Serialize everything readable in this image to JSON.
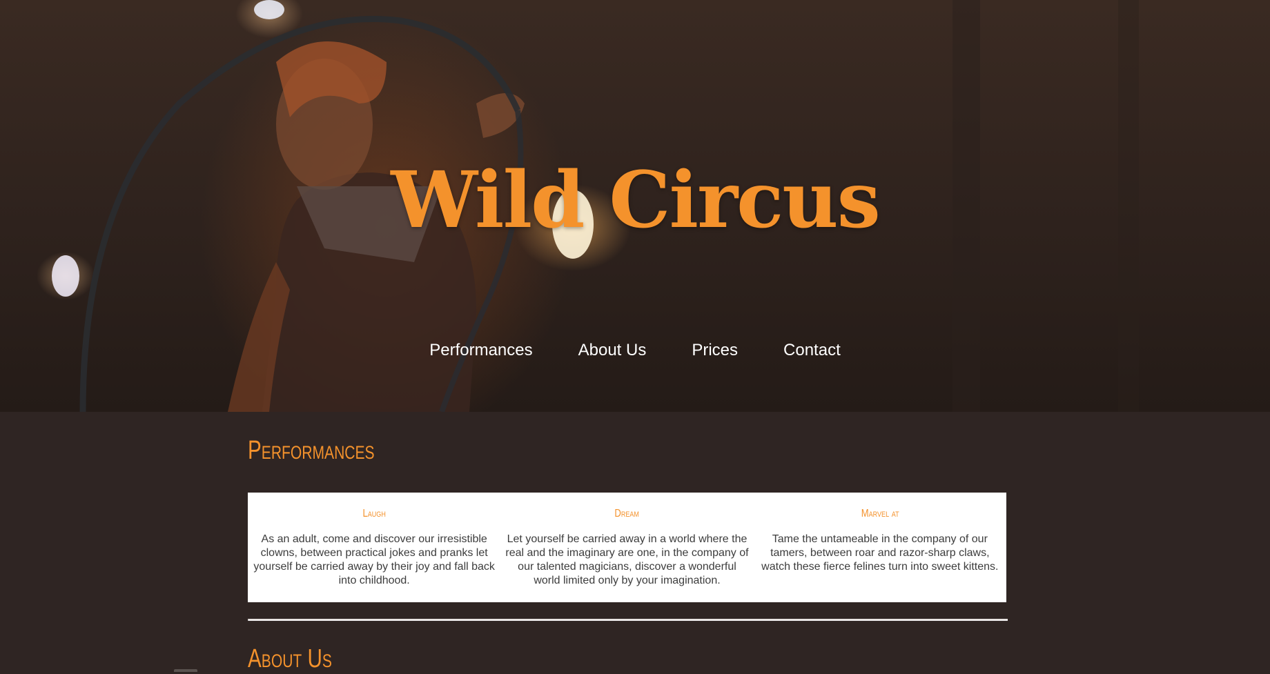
{
  "site": {
    "title": "Wild Circus"
  },
  "nav": {
    "items": [
      {
        "label": "Performances"
      },
      {
        "label": "About Us"
      },
      {
        "label": "Prices"
      },
      {
        "label": "Contact"
      }
    ]
  },
  "performances": {
    "heading": "Performances",
    "cards": [
      {
        "title": "Laugh",
        "text": "As an adult, come and discover our irresistible clowns, between practical jokes and pranks let yourself be carried away by their joy and fall back into childhood."
      },
      {
        "title": "Dream",
        "text": "Let yourself be carried away in a world where the real and the imaginary are one, in the company of our talented magicians, discover a wonderful world limited only by your imagination."
      },
      {
        "title": "Marvel at",
        "text": "Tame the untameable in the company of our tamers, between roar and razor-sharp claws, watch these fierce felines turn into sweet kittens."
      }
    ]
  },
  "about": {
    "heading": "About Us"
  },
  "colors": {
    "accent": "#f4922c",
    "background": "#2f2523",
    "card_background": "#ffffff"
  }
}
